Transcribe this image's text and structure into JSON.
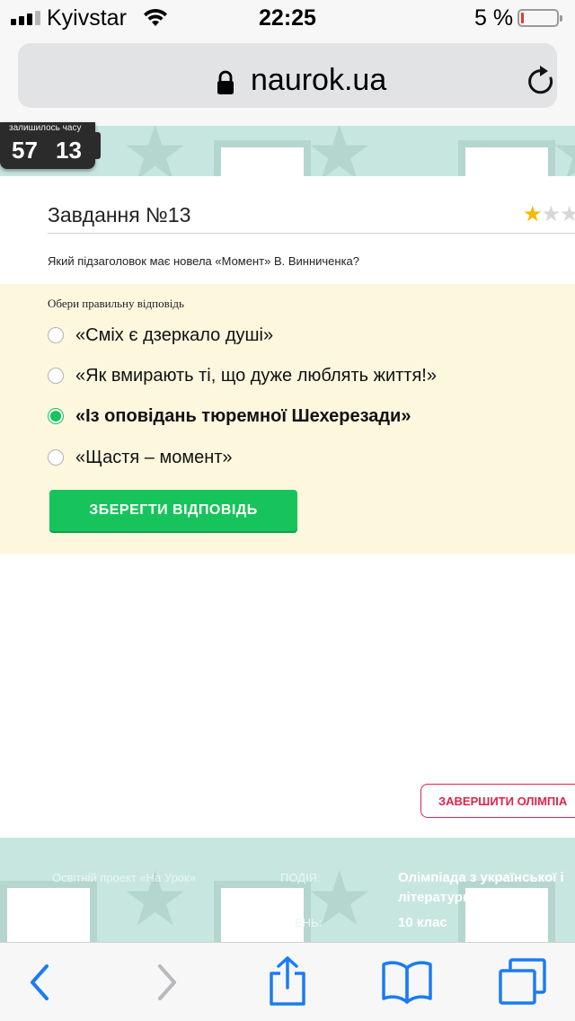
{
  "status_bar": {
    "carrier": "Kyivstar",
    "time": "22:25",
    "battery_percent": "5 %",
    "battery_level": 0.05,
    "signal_bars": 4,
    "signal_active": 3,
    "icons": [
      "signal-icon",
      "wifi-icon",
      "battery-icon"
    ]
  },
  "browser": {
    "domain": "naurok.ua",
    "icons": [
      "lock-icon",
      "reload-icon"
    ]
  },
  "timer": {
    "label": "залишилось часу",
    "minutes": "57",
    "seconds": "13"
  },
  "task": {
    "title": "Завдання №13",
    "rating": 1,
    "rating_max": 3,
    "question": "Який підзаголовок має новела «Момент» В. Винниченка?"
  },
  "answers": {
    "instruction": "Обери правильну відповідь",
    "options": [
      {
        "label": "«Сміх є дзеркало душі»",
        "selected": false
      },
      {
        "label": "«Як вмирають ті, що дуже люблять життя!»",
        "selected": false
      },
      {
        "label": "«Із оповідань тюремної Шехерезади»",
        "selected": true
      },
      {
        "label": "«Щастя – момент»",
        "selected": false
      }
    ],
    "save_label": "ЗБЕРЕГТИ ВІДПОВІДЬ",
    "selected_color": "#16c45a"
  },
  "finish": {
    "label": "ЗАВЕРШИТИ ОЛІМПІА"
  },
  "footer": {
    "project": "Освітній проект «На Урок»",
    "event_label": "ПОДІЯ:",
    "event_value": "Олімпіада з української і",
    "event_value_line2": "літератури",
    "class_label": "ЕНЬ:",
    "class_value": "10 клас"
  },
  "toolbar": {
    "icons": [
      "back-icon",
      "forward-icon",
      "share-icon",
      "bookmarks-icon",
      "tabs-icon"
    ]
  },
  "colors": {
    "accent_green": "#17c45b",
    "finish_red": "#e0244a",
    "hero_bg": "#c8e6e0",
    "answers_bg": "#fdf7de",
    "ios_blue": "#1a7cf3"
  }
}
